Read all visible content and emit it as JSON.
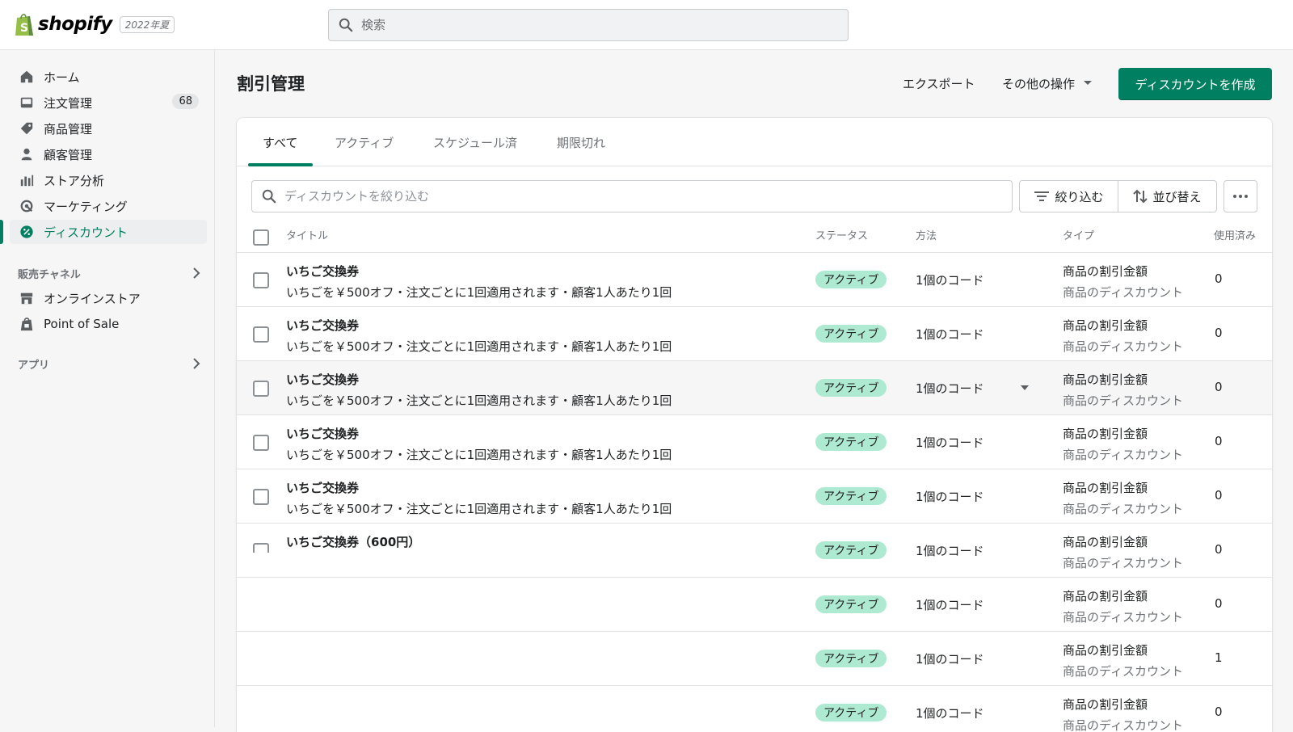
{
  "topbar": {
    "logo_text": "shopify",
    "edition": "2022年夏",
    "search_placeholder": "検索"
  },
  "sidebar": {
    "items": [
      {
        "label": "ホーム",
        "icon": "home-icon"
      },
      {
        "label": "注文管理",
        "icon": "orders-icon",
        "badge": "68"
      },
      {
        "label": "商品管理",
        "icon": "tag-icon"
      },
      {
        "label": "顧客管理",
        "icon": "person-icon"
      },
      {
        "label": "ストア分析",
        "icon": "analytics-icon"
      },
      {
        "label": "マーケティング",
        "icon": "marketing-icon"
      },
      {
        "label": "ディスカウント",
        "icon": "discount-icon",
        "active": true
      }
    ],
    "sales_channels_label": "販売チャネル",
    "channels": [
      {
        "label": "オンラインストア",
        "icon": "store-icon"
      },
      {
        "label": "Point of Sale",
        "icon": "pos-icon"
      }
    ],
    "apps_label": "アプリ"
  },
  "page": {
    "title": "割引管理",
    "export_label": "エクスポート",
    "more_actions_label": "その他の操作",
    "create_label": "ディスカウントを作成"
  },
  "tabs": [
    "すべて",
    "アクティブ",
    "スケジュール済",
    "期限切れ"
  ],
  "filter": {
    "placeholder": "ディスカウントを絞り込む",
    "filter_label": "絞り込む",
    "sort_label": "並び替え"
  },
  "columns": {
    "title": "タイトル",
    "status": "ステータス",
    "method": "方法",
    "type": "タイプ",
    "used": "使用済み"
  },
  "rows": [
    {
      "title": "いちご交換券",
      "sub": "いちごを￥500オフ・注文ごとに1回適用されます・顧客1人あたり1回",
      "status": "アクティブ",
      "method": "1個のコード",
      "type1": "商品の割引金額",
      "type2": "商品のディスカウント",
      "used": "0"
    },
    {
      "title": "いちご交換券",
      "sub": "いちごを￥500オフ・注文ごとに1回適用されます・顧客1人あたり1回",
      "status": "アクティブ",
      "method": "1個のコード",
      "type1": "商品の割引金額",
      "type2": "商品のディスカウント",
      "used": "0"
    },
    {
      "title": "いちご交換券",
      "sub": "いちごを￥500オフ・注文ごとに1回適用されます・顧客1人あたり1回",
      "status": "アクティブ",
      "method": "1個のコード",
      "type1": "商品の割引金額",
      "type2": "商品のディスカウント",
      "used": "0"
    },
    {
      "title": "いちご交換券",
      "sub": "いちごを￥500オフ・注文ごとに1回適用されます・顧客1人あたり1回",
      "status": "アクティブ",
      "method": "1個のコード",
      "type1": "商品の割引金額",
      "type2": "商品のディスカウント",
      "used": "0"
    },
    {
      "title": "いちご交換券",
      "sub": "いちごを￥500オフ・注文ごとに1回適用されます・顧客1人あたり1回",
      "status": "アクティブ",
      "method": "1個のコード",
      "type1": "商品の割引金額",
      "type2": "商品のディスカウント",
      "used": "0"
    },
    {
      "title": "いちご交換券（600円）",
      "sub": "",
      "status": "アクティブ",
      "method": "1個のコード",
      "type1": "商品の割引金額",
      "type2": "商品のディスカウント",
      "used": "0"
    },
    {
      "title": "",
      "sub": "",
      "status": "アクティブ",
      "method": "1個のコード",
      "type1": "商品の割引金額",
      "type2": "商品のディスカウント",
      "used": "0"
    },
    {
      "title": "",
      "sub": "",
      "status": "アクティブ",
      "method": "1個のコード",
      "type1": "商品の割引金額",
      "type2": "商品のディスカウント",
      "used": "1"
    },
    {
      "title": "",
      "sub": "",
      "status": "アクティブ",
      "method": "1個のコード",
      "type1": "商品の割引金額",
      "type2": "商品のディスカウント",
      "used": "0"
    }
  ]
}
